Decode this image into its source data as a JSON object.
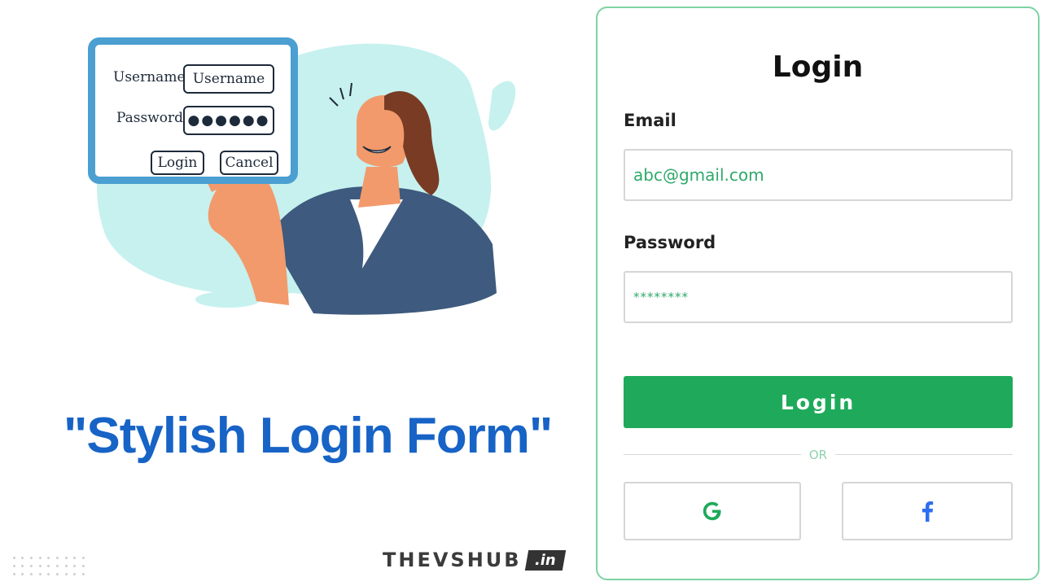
{
  "illustration": {
    "mini_form": {
      "username_label": "Username",
      "username_value": "Username",
      "password_label": "Password",
      "password_value": "●●●●●●",
      "login_label": "Login",
      "cancel_label": "Cancel"
    }
  },
  "headline": "\"Stylish Login Form\"",
  "brand": {
    "name": "THEVSHUB",
    "tld": ".in"
  },
  "login_card": {
    "title": "Login",
    "email_label": "Email",
    "email_value": "abc@gmail.com",
    "password_label": "Password",
    "password_value": "********",
    "login_button": "Login",
    "divider_text": "OR",
    "social": [
      {
        "name": "google",
        "icon": "google-icon",
        "glyph": "G"
      },
      {
        "name": "facebook",
        "icon": "facebook-icon",
        "glyph": "f"
      }
    ]
  },
  "colors": {
    "headline": "#1763c6",
    "accent_green": "#1eaa5a",
    "card_border": "#7ed3a4",
    "mini_frame": "#4b9fd1",
    "blob": "#c6f1ee"
  }
}
